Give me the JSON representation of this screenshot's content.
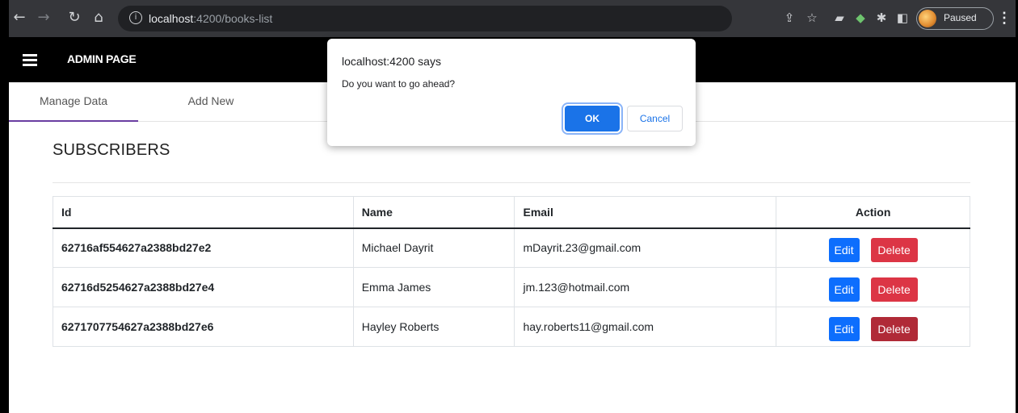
{
  "browser": {
    "url_host": "localhost",
    "url_path": ":4200/books-list",
    "profile_status": "Paused",
    "icons": [
      "back-icon",
      "forward-icon",
      "reload-icon",
      "home-icon",
      "info-icon",
      "share-icon",
      "star-icon",
      "extension-icon",
      "puzzle-icon",
      "sidepanel-icon",
      "menu-icon"
    ]
  },
  "header": {
    "title": "ADMIN PAGE"
  },
  "tabs": [
    {
      "label": "Manage Data",
      "active": true
    },
    {
      "label": "Add New",
      "active": false
    }
  ],
  "section": {
    "title": "SUBSCRIBERS"
  },
  "table": {
    "headers": {
      "id": "Id",
      "name": "Name",
      "email": "Email",
      "action": "Action"
    },
    "rows": [
      {
        "id": "62716af554627a2388bd27e2",
        "name": "Michael Dayrit",
        "email": "mDayrit.23@gmail.com"
      },
      {
        "id": "62716d5254627a2388bd27e4",
        "name": "Emma James",
        "email": "jm.123@hotmail.com"
      },
      {
        "id": "6271707754627a2388bd27e6",
        "name": "Hayley Roberts",
        "email": "hay.roberts11@gmail.com"
      }
    ],
    "edit_label": "Edit",
    "delete_label": "Delete"
  },
  "dialog": {
    "title": "localhost:4200 says",
    "message": "Do you want to go ahead?",
    "ok_label": "OK",
    "cancel_label": "Cancel"
  },
  "colors": {
    "primary": "#0d6efd",
    "danger": "#dc3545",
    "tab_accent": "#6a3ea1",
    "dialog_ok": "#1a73e8"
  }
}
